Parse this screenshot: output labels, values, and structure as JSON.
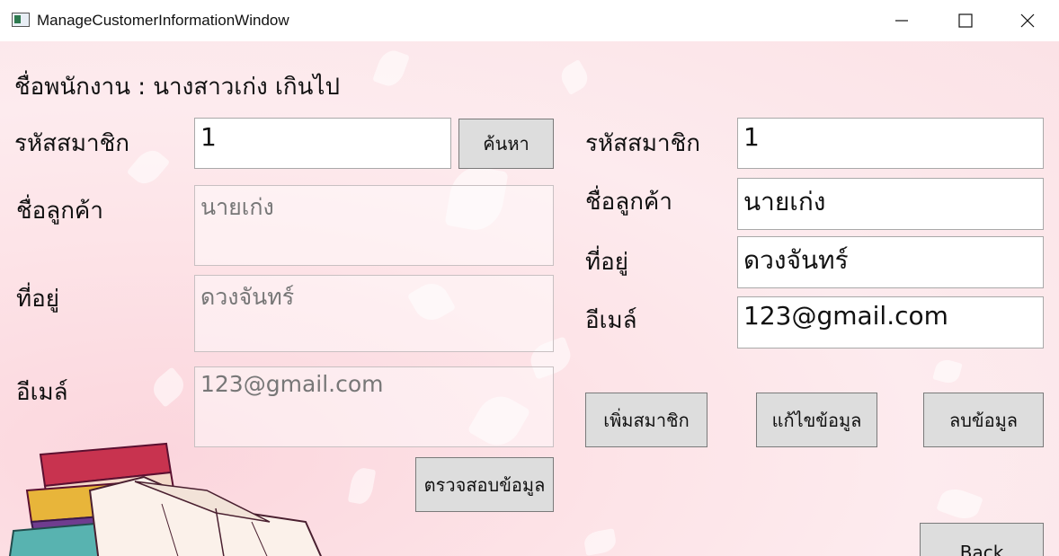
{
  "window": {
    "title": "ManageCustomerInformationWindow"
  },
  "header": {
    "employee_label": "ชื่อพนักงาน  :  นางสาวเก่ง เกินไป"
  },
  "search": {
    "member_id_label": "รหัสสมาชิก",
    "member_id_value": "1",
    "search_button": "ค้นหา",
    "name_label": "ชื่อลูกค้า",
    "name_value": "นายเก่ง",
    "address_label": "ที่อยู่",
    "address_value": "ดวงจันทร์",
    "email_label": "อีเมล์",
    "email_value": "123@gmail.com",
    "verify_button": "ตรวจสอบข้อมูล"
  },
  "edit": {
    "member_id_label": "รหัสสมาชิก",
    "member_id_value": "1",
    "name_label": "ชื่อลูกค้า",
    "name_value": "นายเก่ง",
    "address_label": "ที่อยู่",
    "address_value": "ดวงจันทร์",
    "email_label": "อีเมล์",
    "email_value": "123@gmail.com",
    "add_button": "เพิ่มสมาชิก",
    "update_button": "แก้ไขข้อมูล",
    "delete_button": "ลบข้อมูล",
    "back_button": "Back"
  },
  "icons": {
    "app": "app-icon",
    "minimize": "minimize-icon",
    "maximize": "maximize-icon",
    "close": "close-icon",
    "decoration": "books-illustration"
  }
}
